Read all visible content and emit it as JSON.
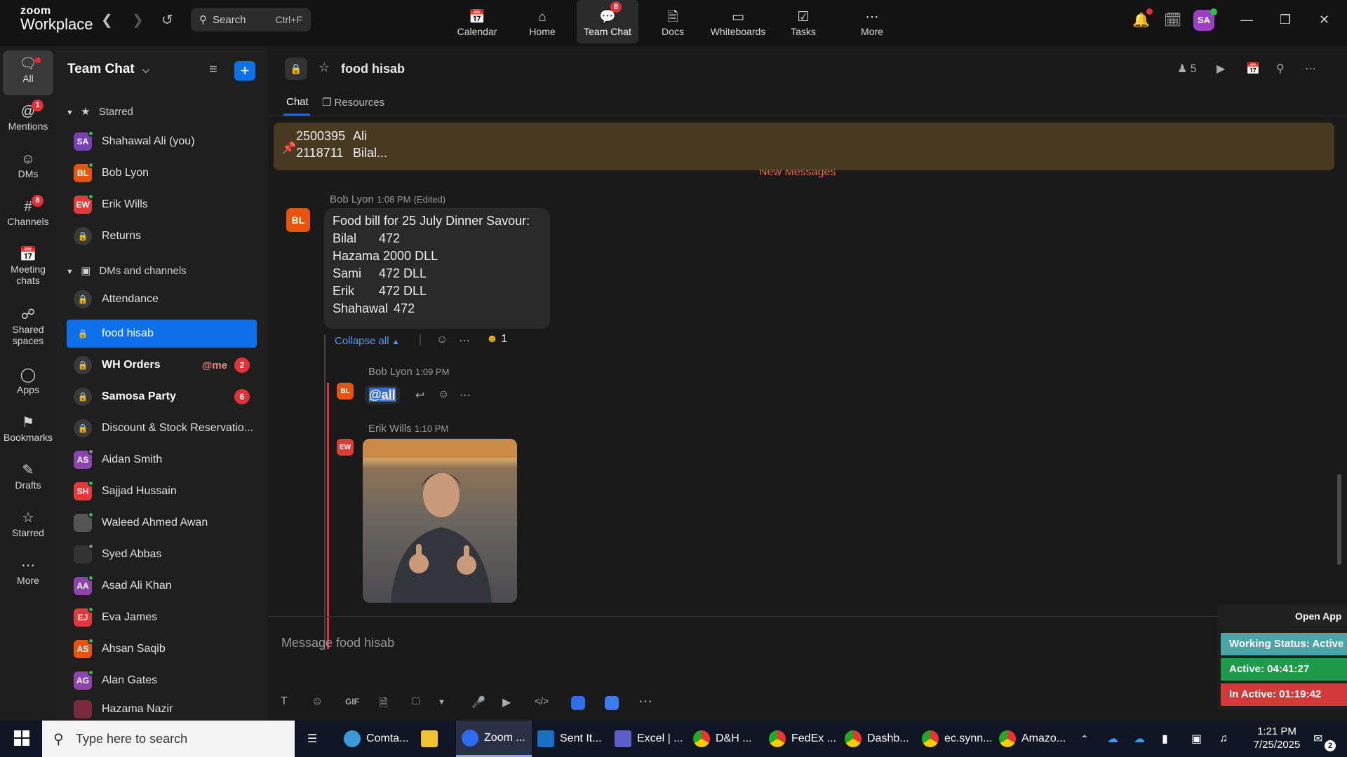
{
  "app": {
    "brand_top": "zoom",
    "brand_bottom": "Workplace"
  },
  "topbar": {
    "search_label": "Search",
    "search_shortcut": "Ctrl+F",
    "nav": [
      {
        "label": "Calendar",
        "icon": "calendar-icon"
      },
      {
        "label": "Home",
        "icon": "home-icon"
      },
      {
        "label": "Team Chat",
        "icon": "chat-icon",
        "badge": "8"
      },
      {
        "label": "Docs",
        "icon": "docs-icon"
      },
      {
        "label": "Whiteboards",
        "icon": "whiteboard-icon"
      },
      {
        "label": "Tasks",
        "icon": "tasks-icon"
      },
      {
        "label": "More",
        "icon": "more-icon"
      }
    ],
    "avatar": "SA"
  },
  "rail": [
    {
      "label": "All"
    },
    {
      "label": "Mentions",
      "badge": "1"
    },
    {
      "label": "DMs"
    },
    {
      "label": "Channels",
      "badge": "8"
    },
    {
      "label": "Meeting chats"
    },
    {
      "label": "Shared spaces"
    },
    {
      "label": "Apps"
    },
    {
      "label": "Bookmarks"
    },
    {
      "label": "Drafts"
    },
    {
      "label": "Starred"
    },
    {
      "label": "More"
    }
  ],
  "list": {
    "title": "Team Chat",
    "starred_label": "Starred",
    "dms_label": "DMs and channels",
    "starred": [
      {
        "initials": "SA",
        "name": "Shahawal Ali (you)",
        "color": "#7a3fb0"
      },
      {
        "initials": "BL",
        "name": "Bob Lyon",
        "color": "#e8540c"
      },
      {
        "initials": "EW",
        "name": "Erik Wills",
        "color": "#e23a3a"
      },
      {
        "name": "Returns"
      }
    ],
    "channels": [
      {
        "name": "Attendance"
      },
      {
        "name": "food hisab"
      },
      {
        "name": "WH Orders",
        "mention": "@me",
        "badge": "2"
      },
      {
        "name": "Samosa Party",
        "badge": "6"
      },
      {
        "name": "Discount & Stock Reservatio..."
      },
      {
        "initials": "AS",
        "name": "Aidan Smith",
        "color": "#8e44ad"
      },
      {
        "initials": "SH",
        "name": "Sajjad Hussain",
        "color": "#e23a3a"
      },
      {
        "initials": "",
        "name": "Waleed Ahmed Awan",
        "color": "#555555"
      },
      {
        "initials": "",
        "name": "Syed Abbas",
        "color": "#333333"
      },
      {
        "initials": "AA",
        "name": "Asad Ali Khan",
        "color": "#8e44ad"
      },
      {
        "initials": "EJ",
        "name": "Eva James",
        "color": "#e23a3a"
      },
      {
        "initials": "AS",
        "name": "Ahsan Saqib",
        "color": "#e8540c"
      },
      {
        "initials": "AG",
        "name": "Alan Gates",
        "color": "#8e44ad"
      },
      {
        "initials": "",
        "name": "Hazama Nazir",
        "color": "#7a2a3a"
      }
    ]
  },
  "channel": {
    "name": "food hisab",
    "member_count": "5",
    "tabs": [
      "Chat",
      "Resources"
    ],
    "pinned": [
      {
        "id": "2500395",
        "name": "Ali"
      },
      {
        "id": "2118711",
        "name": "Bilal..."
      }
    ],
    "new_messages": "New Messages"
  },
  "messages": {
    "m1": {
      "sender": "Bob Lyon",
      "time": "1:08 PM",
      "edited": "(Edited)",
      "initials": "BL",
      "title": "Food bill for 25 July Dinner Savour:",
      "lines": [
        {
          "a": "Bilal",
          "b": "472"
        },
        {
          "a": "Hazama",
          "b": "2000 DLL"
        },
        {
          "a": "Sami",
          "b": "472 DLL"
        },
        {
          "a": "Erik",
          "b": "472 DLL"
        },
        {
          "a": "Shahawal",
          "b": "472"
        }
      ],
      "collapse": "Collapse all",
      "reaction_count": "1"
    },
    "r1": {
      "sender": "Bob Lyon",
      "time": "1:09 PM",
      "initials": "BL",
      "text": "@all"
    },
    "r2": {
      "sender": "Erik Wills",
      "time": "1:10 PM",
      "initials": "EW"
    }
  },
  "composer": {
    "placeholder": "Message food hisab"
  },
  "widget": {
    "open": "Open App",
    "status": "Working Status: Active",
    "active": "Active: 04:41:27",
    "inactive": "In Active: 01:19:42"
  },
  "taskbar": {
    "search": "Type here to search",
    "apps": [
      "Comta...",
      "Zoom ...",
      "Sent It...",
      "Excel | ...",
      "D&H ...",
      "FedEx ...",
      "Dashb...",
      "ec.synn...",
      "Amazo..."
    ],
    "time": "1:21 PM",
    "date": "7/25/2025",
    "notif": "2"
  }
}
